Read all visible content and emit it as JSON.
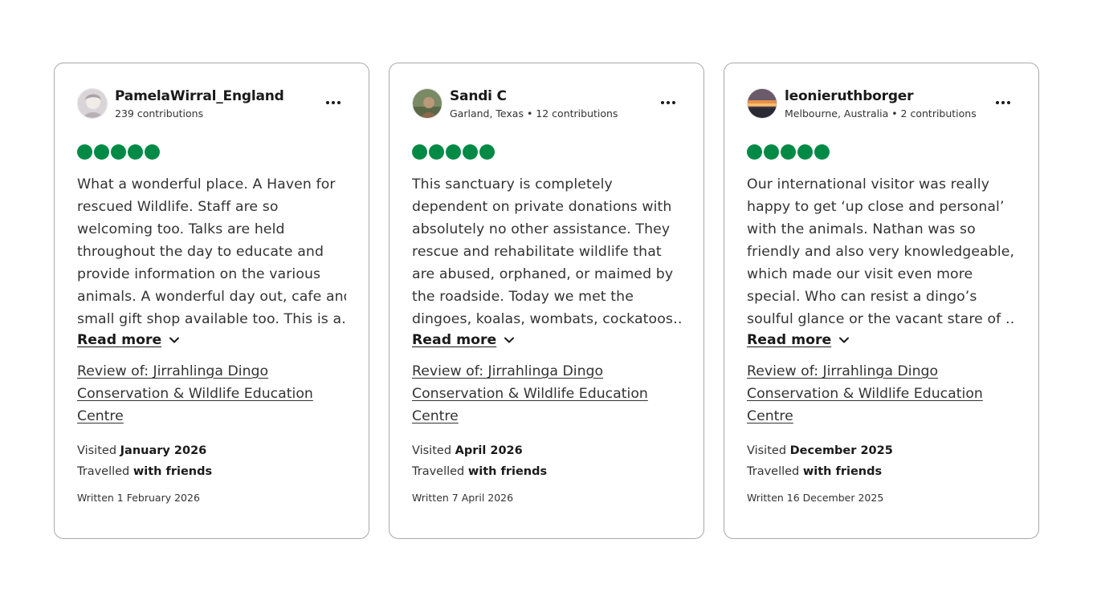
{
  "reviews": [
    {
      "user_name": "PamelaWirral_England",
      "user_meta": "239 contributions",
      "rating": 5,
      "avatar_colors": [
        "#c9c2c6",
        "#e8e4e6",
        "#9e9aa0"
      ],
      "text_lines": [
        "What a wonderful place. A Haven for",
        "rescued Wildlife. Staff are so",
        "welcoming too. Talks are held",
        "throughout the day to educate and",
        "provide information on the various",
        "animals. A wonderful day out, cafe and",
        "small gift shop available too. This is a…"
      ],
      "read_more": "Read more",
      "review_of_lines": [
        "Review of: Jirrahlinga Dingo",
        "Conservation & Wildlife Education",
        "Centre"
      ],
      "visited_label": "Visited",
      "visited_date": "January 2026",
      "travelled_label": "Travelled",
      "travelled_with": "with friends",
      "written": "Written 1 February 2026"
    },
    {
      "user_name": "Sandi C",
      "user_meta": "Garland, Texas • 12 contributions",
      "rating": 5,
      "avatar_colors": [
        "#6b7a5a",
        "#a08a6a",
        "#4c5a3e"
      ],
      "text_lines": [
        "This sanctuary is completely",
        "dependent on private donations with",
        "absolutely no other assistance. They",
        "rescue and rehabilitate wildlife that",
        "are abused, orphaned, or maimed by",
        "the roadside. Today we met the",
        "dingoes, koalas, wombats, cockatoos…"
      ],
      "read_more": "Read more",
      "review_of_lines": [
        "Review of: Jirrahlinga Dingo",
        "Conservation & Wildlife Education",
        "Centre"
      ],
      "visited_label": "Visited",
      "visited_date": "April 2026",
      "travelled_label": "Travelled",
      "travelled_with": "with friends",
      "written": "Written 7 April 2026"
    },
    {
      "user_name": "leonieruthborger",
      "user_meta": "Melbourne, Australia • 2 contributions",
      "rating": 5,
      "avatar_colors": [
        "#e08a3a",
        "#3a3a44",
        "#f0b060"
      ],
      "text_lines": [
        "Our international visitor was really",
        "happy to get ‘up close and personal’",
        "with the animals. Nathan was so",
        "friendly and also very knowledgeable,",
        "which made our visit even more",
        "special. Who can resist a dingo’s",
        "soulful glance or the vacant stare of …"
      ],
      "read_more": "Read more",
      "review_of_lines": [
        "Review of: Jirrahlinga Dingo",
        "Conservation & Wildlife Education",
        "Centre"
      ],
      "visited_label": "Visited",
      "visited_date": "December 2025",
      "travelled_label": "Travelled",
      "travelled_with": "with friends",
      "written": "Written 16 December 2025"
    }
  ],
  "colors": {
    "rating_bubble": "#008a46",
    "border": "#a9a9a9",
    "text": "#333333"
  }
}
